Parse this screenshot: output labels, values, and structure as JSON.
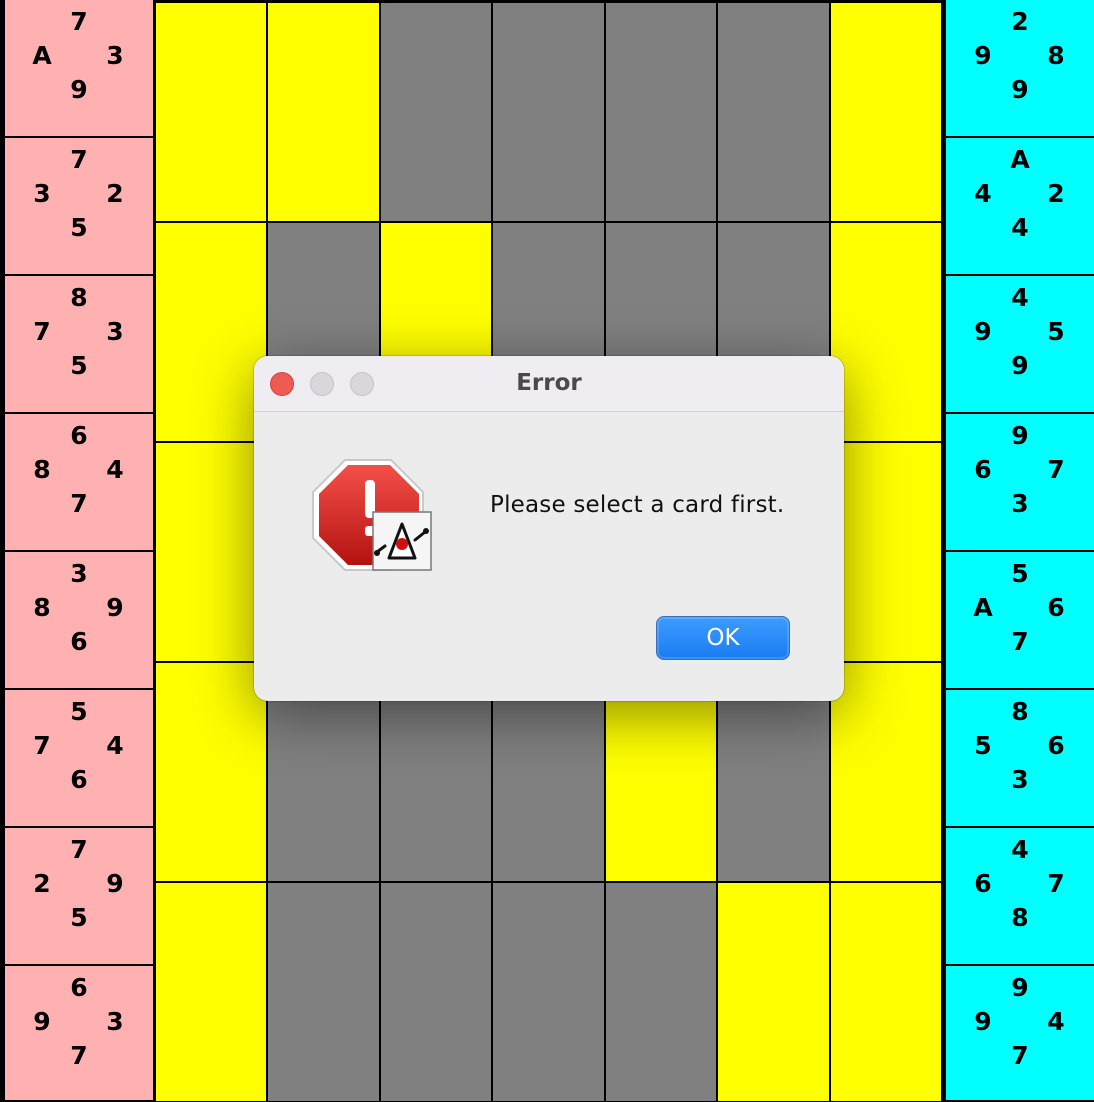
{
  "board": {
    "rows": [
      [
        "Y",
        "Y",
        "G",
        "G",
        "G",
        "G",
        "Y"
      ],
      [
        "Y",
        "G",
        "Y",
        "G",
        "G",
        "G",
        "Y"
      ],
      [
        "Y",
        "G",
        "G",
        "G",
        "G",
        "G",
        "Y"
      ],
      [
        "Y",
        "G",
        "G",
        "G",
        "Y",
        "G",
        "Y"
      ],
      [
        "Y",
        "G",
        "G",
        "G",
        "G",
        "Y",
        "Y"
      ]
    ],
    "colors": {
      "yellow": "#ffff00",
      "gray": "#808080"
    }
  },
  "hands": {
    "red": [
      {
        "top": "7",
        "left": "A",
        "right": "3",
        "bottom": "9"
      },
      {
        "top": "7",
        "left": "3",
        "right": "2",
        "bottom": "5"
      },
      {
        "top": "8",
        "left": "7",
        "right": "3",
        "bottom": "5"
      },
      {
        "top": "6",
        "left": "8",
        "right": "4",
        "bottom": "7"
      },
      {
        "top": "3",
        "left": "8",
        "right": "9",
        "bottom": "6"
      },
      {
        "top": "5",
        "left": "7",
        "right": "4",
        "bottom": "6"
      },
      {
        "top": "7",
        "left": "2",
        "right": "9",
        "bottom": "5"
      },
      {
        "top": "6",
        "left": "9",
        "right": "3",
        "bottom": "7"
      }
    ],
    "blue": [
      {
        "top": "2",
        "left": "9",
        "right": "8",
        "bottom": "9"
      },
      {
        "top": "A",
        "left": "4",
        "right": "2",
        "bottom": "4"
      },
      {
        "top": "4",
        "left": "9",
        "right": "5",
        "bottom": "9"
      },
      {
        "top": "9",
        "left": "6",
        "right": "7",
        "bottom": "3"
      },
      {
        "top": "5",
        "left": "A",
        "right": "6",
        "bottom": "7"
      },
      {
        "top": "8",
        "left": "5",
        "right": "6",
        "bottom": "3"
      },
      {
        "top": "4",
        "left": "6",
        "right": "7",
        "bottom": "8"
      },
      {
        "top": "9",
        "left": "9",
        "right": "4",
        "bottom": "7"
      }
    ],
    "colors": {
      "red": "#ffb0b0",
      "blue": "#00ffff"
    }
  },
  "dialog": {
    "title": "Error",
    "message": "Please select a card first.",
    "ok_label": "OK",
    "icon": "stop-alert-icon"
  }
}
